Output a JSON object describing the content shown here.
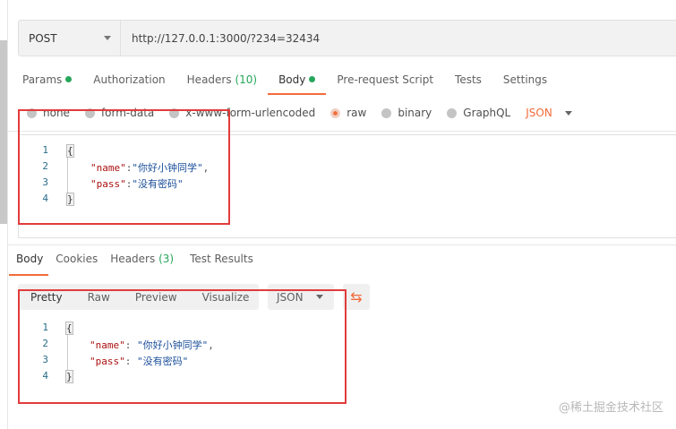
{
  "request": {
    "method": "POST",
    "url": "http://127.0.0.1:3000/?234=32434"
  },
  "request_tabs": [
    {
      "label": "Params"
    },
    {
      "label": "Authorization"
    },
    {
      "label": "Headers",
      "count": "(10)"
    },
    {
      "label": "Body"
    },
    {
      "label": "Pre-request Script"
    },
    {
      "label": "Tests"
    },
    {
      "label": "Settings"
    }
  ],
  "body_types": [
    "none",
    "form-data",
    "x-www-form-urlencoded",
    "raw",
    "binary",
    "GraphQL"
  ],
  "body_format": "JSON",
  "request_code": {
    "lines": [
      "1",
      "2",
      "3",
      "4"
    ],
    "open": "{",
    "close": "}",
    "k1": "\"name\"",
    "v1": "\"你好小钟同学\"",
    "k2": "\"pass\"",
    "v2": "\"没有密码\""
  },
  "response_tabs": [
    {
      "label": "Body"
    },
    {
      "label": "Cookies"
    },
    {
      "label": "Headers",
      "count": "(3)"
    },
    {
      "label": "Test Results"
    }
  ],
  "view_modes": [
    "Pretty",
    "Raw",
    "Preview",
    "Visualize"
  ],
  "response_format": "JSON",
  "response_code": {
    "lines": [
      "1",
      "2",
      "3",
      "4"
    ],
    "open": "{",
    "close": "}",
    "k1": "\"name\"",
    "v1": "\"你好小钟同学\"",
    "k2": "\"pass\"",
    "v2": "\"没有密码\""
  },
  "watermark": "@稀土掘金技术社区",
  "colors": {
    "accent": "#f26b3a",
    "green": "#26a65b",
    "highlight": "#e23b3b"
  }
}
